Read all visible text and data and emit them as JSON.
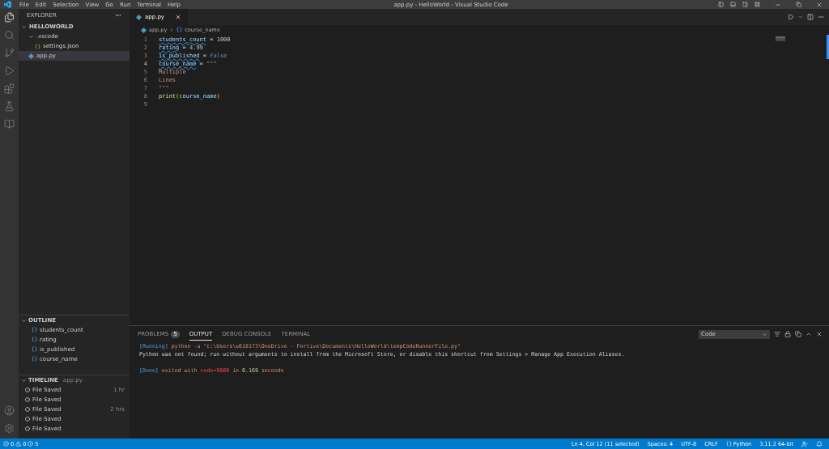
{
  "menu": [
    "File",
    "Edit",
    "Selection",
    "View",
    "Go",
    "Run",
    "Terminal",
    "Help"
  ],
  "window_title": "app.py - HelloWorld - Visual Studio Code",
  "activity_bar": [
    {
      "kind": "files",
      "selected": true
    },
    {
      "kind": "search",
      "selected": false
    },
    {
      "kind": "source-control",
      "selected": false
    },
    {
      "kind": "run",
      "selected": false
    },
    {
      "kind": "extensions",
      "selected": false
    },
    {
      "kind": "testing",
      "selected": false
    },
    {
      "kind": "notebook",
      "selected": false
    }
  ],
  "explorer": {
    "title": "EXPLORER",
    "root": {
      "label": "HELLOWORLD",
      "expanded": true,
      "children": [
        {
          "label": ".vscode",
          "kind": "folder",
          "expanded": true,
          "selected": false,
          "children": [
            {
              "label": "settings.json",
              "kind": "json",
              "selected": false
            }
          ]
        },
        {
          "label": "app.py",
          "kind": "python",
          "selected": true
        }
      ]
    }
  },
  "editor": {
    "tabs": [
      {
        "label": "app.py",
        "selected": true
      }
    ],
    "breadcrumb": [
      "app.py",
      "course_name"
    ],
    "lines": [
      {
        "number": "1",
        "current": false,
        "tokens": [
          {
            "text": "students_count",
            "kind": "variable",
            "underlined": true
          },
          {
            "text": " = ",
            "kind": "plain"
          },
          {
            "text": "1000",
            "kind": "number"
          }
        ]
      },
      {
        "number": "2",
        "current": false,
        "tokens": [
          {
            "text": "rating",
            "kind": "variable",
            "underlined": true
          },
          {
            "text": " = ",
            "kind": "plain"
          },
          {
            "text": "4.99",
            "kind": "number"
          }
        ]
      },
      {
        "number": "3",
        "current": false,
        "tokens": [
          {
            "text": "is_published",
            "kind": "variable",
            "underlined": true
          },
          {
            "text": " = ",
            "kind": "plain"
          },
          {
            "text": "False",
            "kind": "keyword"
          }
        ]
      },
      {
        "number": "4",
        "current": true,
        "tokens": [
          {
            "text": "course_name",
            "kind": "variable",
            "underlined": true
          },
          {
            "text": " = ",
            "kind": "plain"
          },
          {
            "text": "\"\"\"",
            "kind": "string"
          }
        ]
      },
      {
        "number": "5",
        "current": false,
        "tokens": [
          {
            "text": "Multiple",
            "kind": "string"
          }
        ]
      },
      {
        "number": "6",
        "current": false,
        "tokens": [
          {
            "text": "Lines",
            "kind": "string"
          }
        ]
      },
      {
        "number": "7",
        "current": false,
        "tokens": [
          {
            "text": "\"\"\"",
            "kind": "string"
          }
        ]
      },
      {
        "number": "8",
        "current": false,
        "tokens": [
          {
            "text": "print",
            "kind": "function"
          },
          {
            "text": "(",
            "kind": "paren"
          },
          {
            "text": "course_name",
            "kind": "variable",
            "underlined": false
          },
          {
            "text": ")",
            "kind": "paren"
          }
        ]
      },
      {
        "number": "9",
        "current": false
      }
    ]
  },
  "outline": {
    "title": "OUTLINE",
    "expanded": true,
    "items": [
      "students_count",
      "rating",
      "is_published",
      "course_name"
    ]
  },
  "timeline": {
    "title": "TIMELINE",
    "file": "app.py",
    "expanded": true,
    "items": [
      {
        "label": "File Saved",
        "time": "1 hr"
      },
      {
        "label": "File Saved"
      },
      {
        "label": "File Saved",
        "time": "2 hrs"
      },
      {
        "label": "File Saved"
      },
      {
        "label": "File Saved"
      }
    ]
  },
  "panel": {
    "tabs": [
      {
        "label": "PROBLEMS",
        "badge": "5",
        "selected": false
      },
      {
        "label": "OUTPUT",
        "selected": true
      },
      {
        "label": "DEBUG CONSOLE",
        "selected": false
      },
      {
        "label": "TERMINAL",
        "selected": false
      }
    ],
    "channel": "Code",
    "output": [
      {
        "kind": "text",
        "tokens": [
          {
            "text": "[Running]",
            "kind": "tag"
          },
          {
            "text": " python -u \"c:\\Users\\u618173\\OneDrive - Fortive\\Documents\\HelloWorld\\tempCodeRunnerFile.py\"",
            "kind": "string"
          }
        ]
      },
      {
        "kind": "text",
        "tokens": [
          {
            "text": "Python was not found; run without arguments to install from the Microsoft Store, or disable this shortcut from Settings > Manage App Execution Aliases.",
            "kind": "plain"
          }
        ]
      },
      {
        "kind": "blank"
      },
      {
        "kind": "text",
        "tokens": [
          {
            "text": "[Done]",
            "kind": "tag"
          },
          {
            "text": " exited with ",
            "kind": "string"
          },
          {
            "text": "code=9009",
            "kind": "error"
          },
          {
            "text": " in ",
            "kind": "string"
          },
          {
            "text": "0.169",
            "kind": "number"
          },
          {
            "text": " seconds",
            "kind": "string"
          }
        ]
      }
    ]
  },
  "status_bar": {
    "errors": "0",
    "warnings": "0",
    "infos": "5",
    "right": [
      {
        "text": "Ln 4, Col 12 (11 selected)",
        "kind": "text"
      },
      {
        "text": "Spaces: 4",
        "kind": "text"
      },
      {
        "text": "UTF-8",
        "kind": "text"
      },
      {
        "text": "CRLF",
        "kind": "text"
      },
      {
        "text": "Python",
        "kind": "language"
      },
      {
        "text": "3.11.2 64-bit",
        "kind": "text"
      }
    ]
  }
}
